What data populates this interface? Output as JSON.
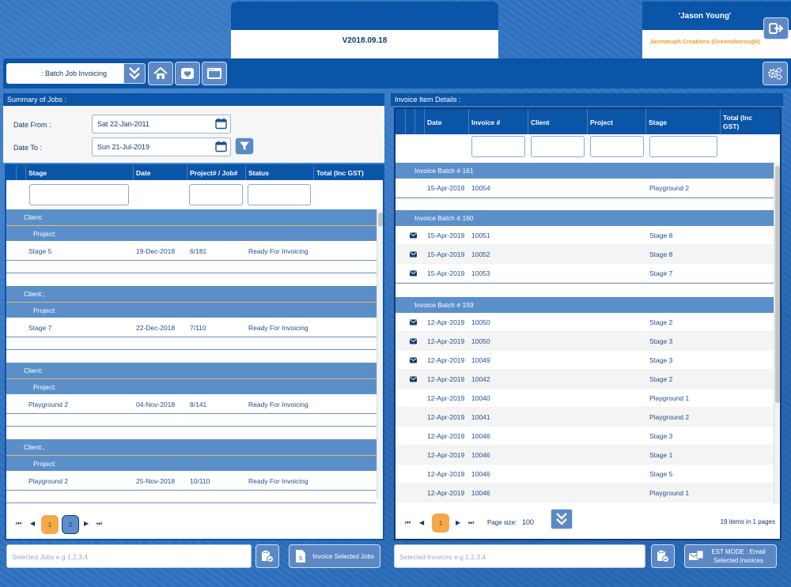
{
  "header": {
    "version": "V2018.09.18",
    "user_name": "'Jason Young'",
    "company": "Jasmatuph Creations (Greensborough)"
  },
  "toolbar": {
    "menu_label": ": Batch Job Invoicing"
  },
  "left": {
    "title": "Summary of Jobs :",
    "date_from_label": "Date From :",
    "date_from_value": "Sat 22-Jan-2011",
    "date_to_label": "Date To :",
    "date_to_value": "Sun 21-Jul-2019",
    "columns": [
      "Stage",
      "Date",
      "Project# / Job#",
      "Status",
      "Total (Inc GST)"
    ],
    "groups": [
      {
        "client": "Client:",
        "project": "Project:",
        "stage": "Stage 5",
        "date": "19-Dec-2018",
        "job": "6/181",
        "status": "Ready For Invoicing"
      },
      {
        "client": "Client:,",
        "project": "Project:",
        "stage": "Stage 7",
        "date": "22-Dec-2018",
        "job": "7/110",
        "status": "Ready For Invoicing"
      },
      {
        "client": "Client:",
        "project": "Project:",
        "stage": "Playground 2",
        "date": "04-Nov-2018",
        "job": "8/141",
        "status": "Ready For Invoicing"
      },
      {
        "client": "Client:,",
        "project": "Project:",
        "stage": "Playground 2",
        "date": "25-Nov-2018",
        "job": "10/110",
        "status": "Ready For Invoicing"
      }
    ],
    "pages": [
      "1",
      "2"
    ],
    "selected_placeholder": "Selected Jobs e.g 1,2,3,4",
    "invoice_button": "Invoice Selected Jobs"
  },
  "right": {
    "title": "Invoice Item Details :",
    "columns": [
      "Date",
      "Invoice #",
      "Client",
      "Project",
      "Stage",
      "Total (Inc GST)"
    ],
    "batches": [
      {
        "label": "Invoice Batch # 161",
        "rows": [
          {
            "email": false,
            "date": "15-Apr-2019",
            "invoice": "10054",
            "stage": "Playground 2"
          }
        ]
      },
      {
        "label": "Invoice Batch # 160",
        "rows": [
          {
            "email": true,
            "date": "15-Apr-2019",
            "invoice": "10051",
            "stage": "Stage 8"
          },
          {
            "email": true,
            "date": "15-Apr-2019",
            "invoice": "10052",
            "stage": "Stage 8"
          },
          {
            "email": true,
            "date": "15-Apr-2019",
            "invoice": "10053",
            "stage": "Stage 7"
          }
        ]
      },
      {
        "label": "Invoice Batch # 159",
        "rows": [
          {
            "email": true,
            "date": "12-Apr-2019",
            "invoice": "10050",
            "stage": "Stage 2"
          },
          {
            "email": true,
            "date": "12-Apr-2019",
            "invoice": "10050",
            "stage": "Stage 3"
          },
          {
            "email": true,
            "date": "12-Apr-2019",
            "invoice": "10049",
            "stage": "Stage 3"
          },
          {
            "email": true,
            "date": "12-Apr-2019",
            "invoice": "10042",
            "stage": "Stage 2"
          },
          {
            "email": false,
            "date": "12-Apr-2019",
            "invoice": "10040",
            "stage": "Playground 1"
          },
          {
            "email": false,
            "date": "12-Apr-2019",
            "invoice": "10041",
            "stage": "Playground 2"
          },
          {
            "email": false,
            "date": "12-Apr-2019",
            "invoice": "10046",
            "stage": "Stage 3"
          },
          {
            "email": false,
            "date": "12-Apr-2019",
            "invoice": "10046",
            "stage": "Stage 1"
          },
          {
            "email": false,
            "date": "12-Apr-2019",
            "invoice": "10046",
            "stage": "Stage 5"
          },
          {
            "email": false,
            "date": "12-Apr-2019",
            "invoice": "10046",
            "stage": "Playground 1"
          }
        ]
      }
    ],
    "current_page": "1",
    "page_size_label": "Page size:",
    "page_size_value": "100",
    "items_count": "19",
    "items_text": "items in",
    "pages_count": "1",
    "pages_text": "pages",
    "selected_placeholder": "Selected Invoices e.g 1,2,3,4",
    "email_button": "EST MODE : Email Selected Invoices"
  },
  "icons": {
    "logout": "logout-icon",
    "home": "home-icon",
    "heart": "heart-icon",
    "window": "window-icon",
    "settings": "settings-icon"
  },
  "colors": {
    "primary": "#0b55a8",
    "group": "#5b8fca",
    "button": "#5c88c5",
    "accent": "#f29b2c"
  }
}
